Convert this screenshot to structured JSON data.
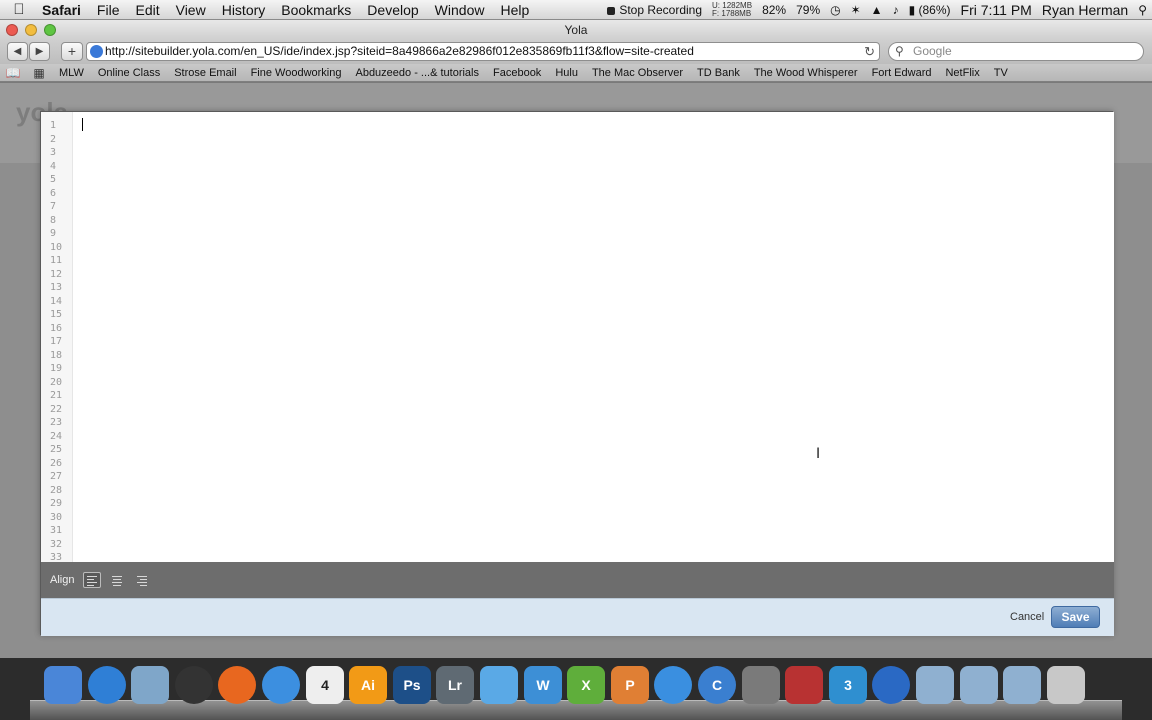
{
  "menubar": {
    "items": [
      "Safari",
      "File",
      "Edit",
      "View",
      "History",
      "Bookmarks",
      "Develop",
      "Window",
      "Help"
    ],
    "recording": "Stop Recording",
    "mem_used": "U: 1282MB",
    "mem_free": "F: 1788MB",
    "cpu": "82%",
    "disk": "79%",
    "battery": "(86%)",
    "clock": "Fri 7:11 PM",
    "user": "Ryan Herman"
  },
  "window": {
    "title": "Yola"
  },
  "toolbar": {
    "url": "http://sitebuilder.yola.com/en_US/ide/index.jsp?siteid=8a49866a2e82986f012e835869fb11f3&flow=site-created",
    "search_placeholder": "Google"
  },
  "bookmarks": [
    "MLW",
    "Online Class",
    "Strose Email",
    "Fine Woodworking",
    "Abduzeedo - ...& tutorials",
    "Facebook",
    "Hulu",
    "The Mac Observer",
    "TD Bank",
    "The Wood Whisperer",
    "Fort Edward",
    "NetFlix",
    "TV"
  ],
  "page_bg": {
    "logo": "yola"
  },
  "editor": {
    "line_numbers": [
      "1",
      "2",
      "3",
      "4",
      "5",
      "6",
      "7",
      "8",
      "9",
      "10",
      "11",
      "12",
      "13",
      "14",
      "15",
      "16",
      "17",
      "18",
      "19",
      "20",
      "21",
      "22",
      "23",
      "24",
      "25",
      "26",
      "27",
      "28",
      "29",
      "30",
      "31",
      "32",
      "33"
    ],
    "align_label": "Align",
    "align_options": [
      "align-left",
      "align-center",
      "align-right"
    ],
    "active_align": "align-left"
  },
  "footer": {
    "cancel_label": "Cancel",
    "save_label": "Save"
  },
  "dock": {
    "apps": [
      {
        "name": "finder",
        "label": "",
        "color": "#4a86d8"
      },
      {
        "name": "app-store",
        "label": "",
        "color": "#2f7fd6"
      },
      {
        "name": "preview",
        "label": "",
        "color": "#7fa6c9"
      },
      {
        "name": "dashboard",
        "label": "",
        "color": "#333333"
      },
      {
        "name": "firefox",
        "label": "",
        "color": "#e8671f"
      },
      {
        "name": "safari",
        "label": "",
        "color": "#3c8fe0"
      },
      {
        "name": "ical",
        "label": "4",
        "color": "#eeeeee"
      },
      {
        "name": "illustrator",
        "label": "Ai",
        "color": "#f29a16"
      },
      {
        "name": "photoshop",
        "label": "Ps",
        "color": "#1d4f88"
      },
      {
        "name": "lightroom",
        "label": "Lr",
        "color": "#5f6a73"
      },
      {
        "name": "textmate",
        "label": "",
        "color": "#5aa9e6"
      },
      {
        "name": "word",
        "label": "W",
        "color": "#3d8fd6"
      },
      {
        "name": "excel",
        "label": "X",
        "color": "#5fae3b"
      },
      {
        "name": "powerpoint",
        "label": "P",
        "color": "#e07f34"
      },
      {
        "name": "itunes",
        "label": "",
        "color": "#3a8fe0"
      },
      {
        "name": "coda",
        "label": "C",
        "color": "#3a7fd0"
      },
      {
        "name": "system-preferences",
        "label": "",
        "color": "#7a7a7a"
      },
      {
        "name": "filezilla",
        "label": "",
        "color": "#b83232"
      },
      {
        "name": "dreamweaver-3",
        "label": "3",
        "color": "#2f8fd0"
      },
      {
        "name": "quicktime",
        "label": "",
        "color": "#2a69c4"
      },
      {
        "name": "applications-folder",
        "label": "",
        "color": "#8fb0d0"
      },
      {
        "name": "documents-folder",
        "label": "",
        "color": "#8fb0d0"
      },
      {
        "name": "downloads-folder",
        "label": "",
        "color": "#8fb0d0"
      },
      {
        "name": "trash",
        "label": "",
        "color": "#c8c8c8"
      }
    ]
  }
}
